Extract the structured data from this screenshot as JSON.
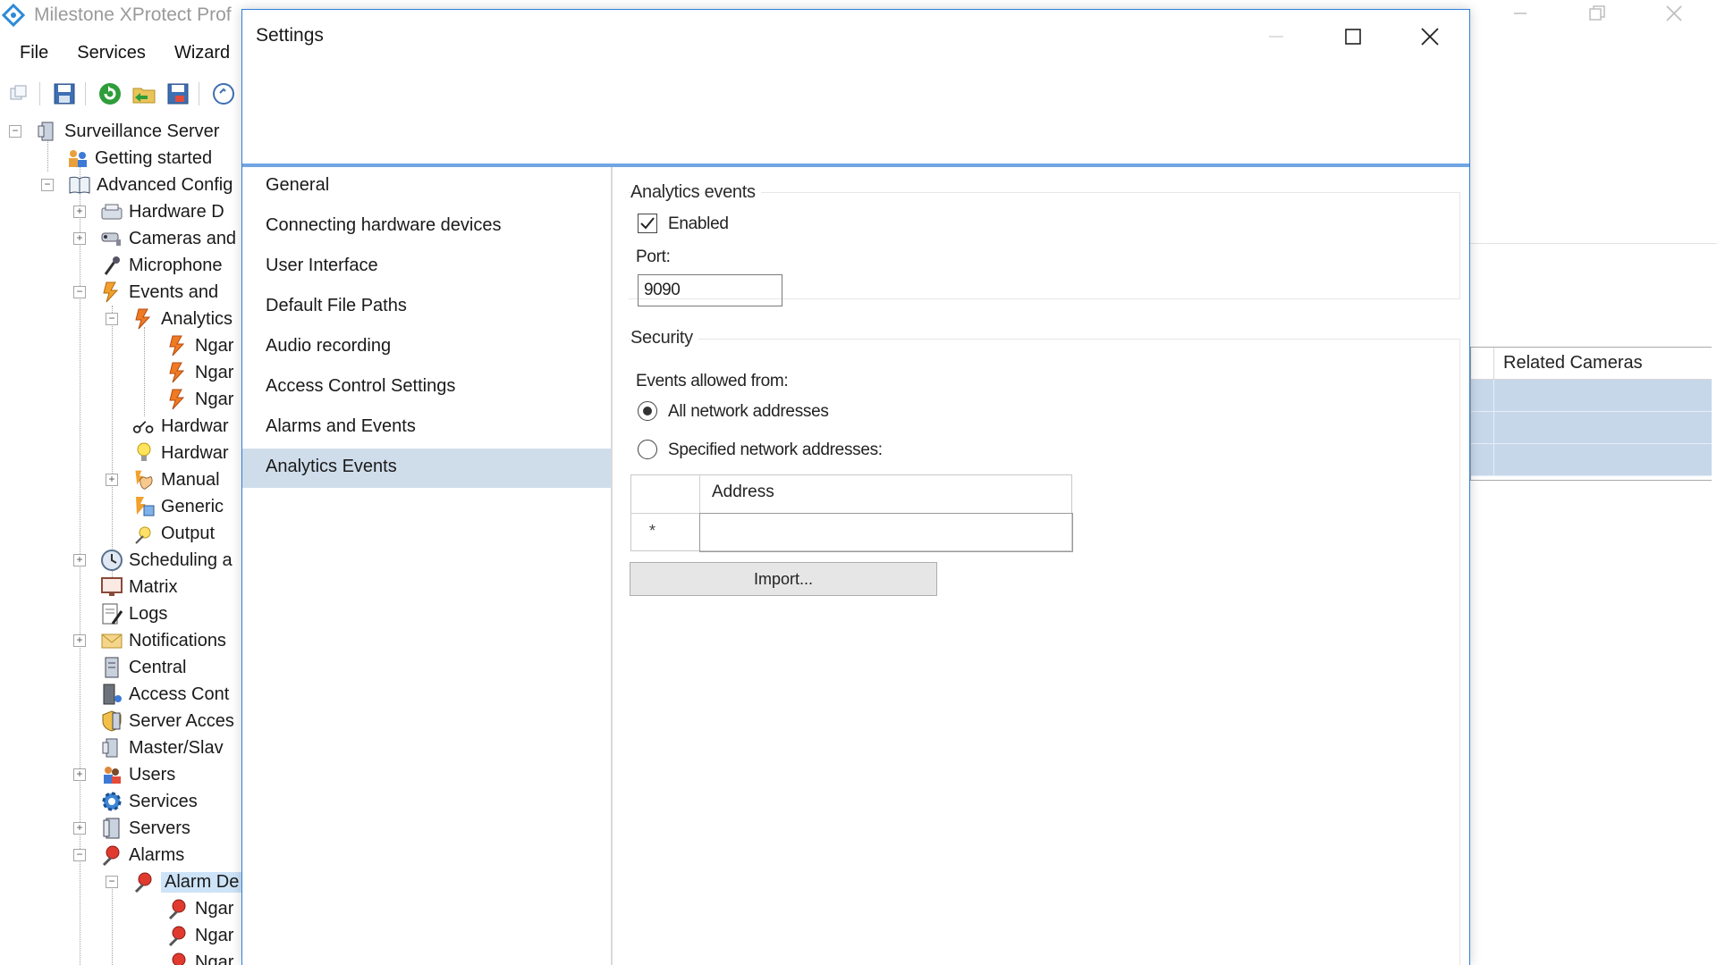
{
  "app": {
    "title": "Milestone XProtect Prof",
    "menu": [
      "File",
      "Services",
      "Wizard"
    ],
    "toolbar_icons": [
      "copy-icon",
      "save-icon",
      "refresh-icon",
      "folder-back-icon",
      "save-as-icon",
      "help-icon"
    ],
    "window_controls": [
      "minimize-icon",
      "restore-icon",
      "close-icon"
    ]
  },
  "tree": {
    "items": [
      {
        "label": "Surveillance Server",
        "icon": "server-icon"
      },
      {
        "label": "Getting started",
        "icon": "people-icon"
      },
      {
        "label": "Advanced Config",
        "icon": "book-icon"
      },
      {
        "label": "Hardware D",
        "icon": "hardware-icon"
      },
      {
        "label": "Cameras and",
        "icon": "camera-icon"
      },
      {
        "label": "Microphone",
        "icon": "microphone-icon"
      },
      {
        "label": "Events and",
        "icon": "event-icon"
      },
      {
        "label": "Analytics",
        "icon": "event-icon"
      },
      {
        "label": "Ngar",
        "icon": "event-icon"
      },
      {
        "label": "Ngar",
        "icon": "event-icon"
      },
      {
        "label": "Ngar",
        "icon": "event-icon"
      },
      {
        "label": "Hardwar",
        "icon": "hardware-event-icon"
      },
      {
        "label": "Hardwar",
        "icon": "lightbulb-icon"
      },
      {
        "label": "Manual",
        "icon": "hand-icon"
      },
      {
        "label": "Generic",
        "icon": "generic-event-icon"
      },
      {
        "label": "Output",
        "icon": "output-icon"
      },
      {
        "label": "Scheduling a",
        "icon": "clock-icon"
      },
      {
        "label": "Matrix",
        "icon": "matrix-icon"
      },
      {
        "label": "Logs",
        "icon": "log-icon"
      },
      {
        "label": "Notifications",
        "icon": "mail-icon"
      },
      {
        "label": "Central",
        "icon": "central-icon"
      },
      {
        "label": "Access Cont",
        "icon": "access-icon"
      },
      {
        "label": "Server Acces",
        "icon": "shield-icon"
      },
      {
        "label": "Master/Slav",
        "icon": "server-icon"
      },
      {
        "label": "Users",
        "icon": "users-icon"
      },
      {
        "label": "Services",
        "icon": "gear-icon"
      },
      {
        "label": "Servers",
        "icon": "servers-icon"
      },
      {
        "label": "Alarms",
        "icon": "alarm-icon"
      },
      {
        "label": "Alarm De",
        "icon": "alarm-icon"
      },
      {
        "label": "Ngar",
        "icon": "alarm-icon"
      },
      {
        "label": "Ngar",
        "icon": "alarm-icon"
      },
      {
        "label": "Ngar",
        "icon": "alarm-icon"
      }
    ]
  },
  "related_panel": {
    "header": "Related Cameras"
  },
  "dialog": {
    "title": "Settings",
    "controls": [
      "minimize-icon",
      "maximize-icon",
      "close-icon"
    ],
    "nav": [
      "General",
      "Connecting hardware devices",
      "User Interface",
      "Default File Paths",
      "Audio recording",
      "Access Control Settings",
      "Alarms and Events",
      "Analytics Events"
    ],
    "active_nav": "Analytics Events",
    "analytics": {
      "title": "Analytics events",
      "enabled_label": "Enabled",
      "enabled": true,
      "port_label": "Port:",
      "port_value": "9090"
    },
    "security": {
      "title": "Security",
      "allowed_label": "Events allowed from:",
      "option_all": "All network addresses",
      "option_specified": "Specified network addresses:",
      "selected": "all",
      "grid_header": "Address",
      "grid_new_row_marker": "*",
      "import_label": "Import..."
    }
  }
}
